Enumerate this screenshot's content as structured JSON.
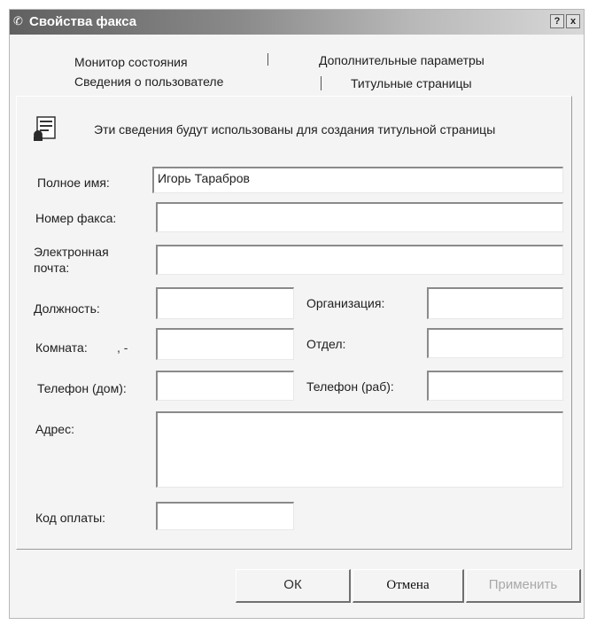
{
  "window": {
    "title": "Свойства факса",
    "help_btn": "?",
    "close_btn": "x"
  },
  "tabs": {
    "monitor": "Монитор состояния",
    "advanced": "Дополнительные параметры",
    "user_info": "Сведения о пользователе",
    "cover_pages": "Титульные страницы"
  },
  "info_text": "Эти сведения будут использованы для создания титульной страницы",
  "fields": {
    "full_name": {
      "label": "Полное имя:",
      "value": "Игорь Тарабров"
    },
    "fax_number": {
      "label": "Номер факса:",
      "value": ""
    },
    "email": {
      "label_line1": "Электронная",
      "label_line2": "почта:",
      "value": ""
    },
    "position": {
      "label": "Должность:",
      "value": ""
    },
    "organization": {
      "label": "Организация:",
      "value": ""
    },
    "room": {
      "label": "Комната:",
      "value": ""
    },
    "department": {
      "label": "Отдел:",
      "value": ""
    },
    "home_phone": {
      "label": "Телефон (дом):",
      "value": ""
    },
    "work_phone": {
      "label": "Телефон (раб):",
      "value": ""
    },
    "address": {
      "label": "Адрес:",
      "value": ""
    },
    "billing_code": {
      "label": "Код оплаты:",
      "value": ""
    }
  },
  "buttons": {
    "ok": "ОК",
    "cancel": "Отмена",
    "apply": "Применить"
  },
  "icons": {
    "title_icon": "fax-icon",
    "info_icon": "user-card-icon"
  }
}
